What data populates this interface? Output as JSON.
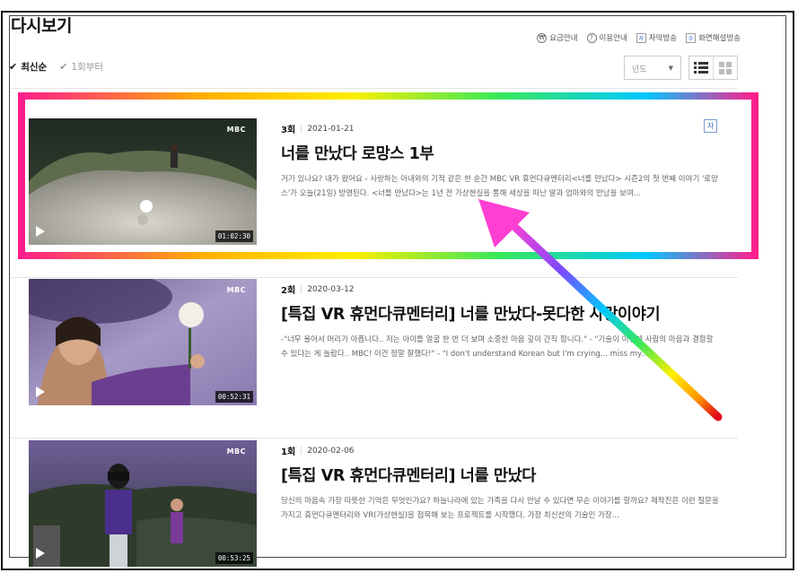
{
  "page": {
    "title": "다시보기"
  },
  "top_links": [
    {
      "icon": "won-icon",
      "glyph": "₩",
      "label": "요금안내"
    },
    {
      "icon": "help-icon",
      "glyph": "?",
      "label": "이용안내"
    },
    {
      "icon": "subtitle-icon",
      "glyph": "자",
      "label": "자막방송"
    },
    {
      "icon": "sign-language-icon",
      "glyph": "수",
      "label": "화면해설방송"
    }
  ],
  "sort": {
    "latest": "최신순",
    "first": "1회부터"
  },
  "year_select": {
    "placeholder": "년도"
  },
  "episodes": [
    {
      "number": "3회",
      "date": "2021-01-21",
      "title": "너를 만났다 로망스 1부",
      "desc": "거기 있나요? 내가 왔어요 - 사랑하는 아내와의 기적 같은 한 순간 MBC VR 휴먼다큐멘터리<너를 만났다> 시즌2의 첫 번째 이야기 '로망스'가 오늘(21일) 방영된다. <너를 만났다>는 1년 전 가상현실을 통해 세상을 떠난 딸과 엄마와의 만남을 보여...",
      "duration": "01:02:30",
      "channel": "MBC",
      "badge": "자"
    },
    {
      "number": "2회",
      "date": "2020-03-12",
      "title": "[특집 VR 휴먼다큐멘터리] 너를 만났다-못다한 사랑이야기",
      "desc": "-\"너무 울어서 머리가 아픕니다.. 저는 아이를 얼굴 한 번 더 보며 소중한 마음 깊이 간직 합니다.\" - \"기술이 이렇게 사람의 마음과 결합할 수 있다는 게 놀랍다.. MBC! 이건 정말 잘했다!\" - \"I don't understand Korean but I'm crying... miss my...",
      "duration": "00:52:31",
      "channel": "MBC"
    },
    {
      "number": "1회",
      "date": "2020-02-06",
      "title": "[특집 VR 휴먼다큐멘터리] 너를 만났다",
      "desc": "당신의 마음속 가장 따뜻한 기억은 무엇인가요? 하늘나라에 있는 가족을 다시 만날 수 있다면 무슨 이야기를 할까요? 제작진은 이런 질문을 가지고 휴먼다큐멘터리와 VR(가상현실)을 접목해 보는 프로젝트를 시작했다. 가장 최신선의 기술인 가장...",
      "duration": "00:53:25",
      "channel": "MBC"
    }
  ],
  "colors": {
    "highlight_border": "#ff1f8c",
    "arrow_head": "#ff3fd2",
    "badge_border": "#7a9ccf"
  }
}
